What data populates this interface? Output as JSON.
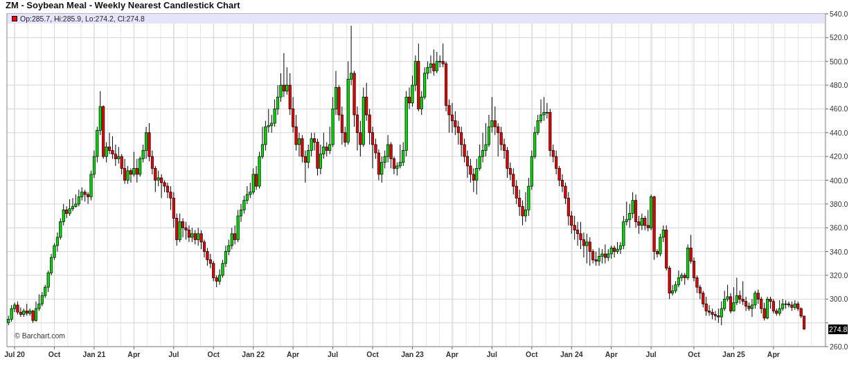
{
  "title": "ZM - Soybean Meal - Weekly Nearest Candlestick Chart",
  "legend": {
    "text": "Op:285.7, Hi:285.9, Lo:274.2, Cl:274.8"
  },
  "last_price": "274.8",
  "copyright": "© Barchart.com",
  "chart_data": {
    "type": "candlestick",
    "grid": true,
    "ylim": [
      260,
      540
    ],
    "yticks": [
      {
        "value": 260,
        "label": "260.0"
      },
      {
        "value": 300,
        "label": "300.0"
      },
      {
        "value": 320,
        "label": "320.0"
      },
      {
        "value": 340,
        "label": "340.0"
      },
      {
        "value": 360,
        "label": "360.0"
      },
      {
        "value": 380,
        "label": "380.0"
      },
      {
        "value": 400,
        "label": "400.0"
      },
      {
        "value": 420,
        "label": "420.0"
      },
      {
        "value": 440,
        "label": "440.0"
      },
      {
        "value": 460,
        "label": "460.0"
      },
      {
        "value": 480,
        "label": "480.0"
      },
      {
        "value": 500,
        "label": "500.0"
      },
      {
        "value": 520,
        "label": "520.0"
      },
      {
        "value": 540,
        "label": "540.0"
      }
    ],
    "categories": [
      null,
      null,
      "Jul 20",
      null,
      null,
      null,
      null,
      null,
      null,
      null,
      null,
      null,
      null,
      null,
      null,
      "Oct",
      null,
      null,
      null,
      null,
      null,
      null,
      null,
      null,
      null,
      null,
      null,
      null,
      "Jan 21",
      null,
      null,
      null,
      null,
      null,
      null,
      null,
      null,
      null,
      null,
      null,
      null,
      "Apr",
      null,
      null,
      null,
      null,
      null,
      null,
      null,
      null,
      null,
      null,
      null,
      null,
      "Jul",
      null,
      null,
      null,
      null,
      null,
      null,
      null,
      null,
      null,
      null,
      null,
      null,
      "Oct",
      null,
      null,
      null,
      null,
      null,
      null,
      null,
      null,
      null,
      null,
      null,
      null,
      "Jan 22",
      null,
      null,
      null,
      null,
      null,
      null,
      null,
      null,
      null,
      null,
      null,
      null,
      "Apr",
      null,
      null,
      null,
      null,
      null,
      null,
      null,
      null,
      null,
      null,
      null,
      null,
      "Jul",
      null,
      null,
      null,
      null,
      null,
      null,
      null,
      null,
      null,
      null,
      null,
      null,
      "Oct",
      null,
      null,
      null,
      null,
      null,
      null,
      null,
      null,
      null,
      null,
      null,
      null,
      "Jan 23",
      null,
      null,
      null,
      null,
      null,
      null,
      null,
      null,
      null,
      null,
      null,
      null,
      "Apr",
      null,
      null,
      null,
      null,
      null,
      null,
      null,
      null,
      null,
      null,
      null,
      null,
      "Jul",
      null,
      null,
      null,
      null,
      null,
      null,
      null,
      null,
      null,
      null,
      null,
      null,
      "Oct",
      null,
      null,
      null,
      null,
      null,
      null,
      null,
      null,
      null,
      null,
      null,
      null,
      "Jan 24",
      null,
      null,
      null,
      null,
      null,
      null,
      null,
      null,
      null,
      null,
      null,
      null,
      "Apr",
      null,
      null,
      null,
      null,
      null,
      null,
      null,
      null,
      null,
      null,
      null,
      null,
      "Jul",
      null,
      null,
      null,
      null,
      null,
      null,
      null,
      null,
      null,
      null,
      null,
      null,
      null,
      "Oct",
      null,
      null,
      null,
      null,
      null,
      null,
      null,
      null,
      null,
      null,
      null,
      null,
      "Jan 25",
      null,
      null,
      null,
      null,
      null,
      null,
      null,
      null,
      null,
      null,
      null,
      null,
      "Apr",
      null,
      null,
      null,
      null,
      null,
      null,
      null,
      null,
      null,
      null
    ],
    "ohlc": [
      [
        280,
        286,
        278,
        283
      ],
      [
        283,
        295,
        281,
        292
      ],
      [
        292,
        297,
        289,
        295
      ],
      [
        295,
        298,
        287,
        289
      ],
      [
        289,
        293,
        285,
        287
      ],
      [
        287,
        292,
        285,
        290
      ],
      [
        290,
        296,
        286,
        288
      ],
      [
        288,
        292,
        286,
        290
      ],
      [
        290,
        291,
        280,
        282
      ],
      [
        282,
        298,
        281,
        292
      ],
      [
        292,
        304,
        290,
        296
      ],
      [
        296,
        306,
        294,
        303
      ],
      [
        303,
        312,
        301,
        310
      ],
      [
        310,
        324,
        306,
        322
      ],
      [
        322,
        338,
        320,
        335
      ],
      [
        335,
        347,
        333,
        345
      ],
      [
        345,
        356,
        340,
        352
      ],
      [
        352,
        368,
        350,
        365
      ],
      [
        365,
        380,
        362,
        375
      ],
      [
        375,
        378,
        368,
        372
      ],
      [
        372,
        384,
        370,
        376
      ],
      [
        376,
        385,
        374,
        378
      ],
      [
        378,
        388,
        377,
        380
      ],
      [
        380,
        392,
        378,
        386
      ],
      [
        386,
        394,
        383,
        390
      ],
      [
        390,
        392,
        382,
        388
      ],
      [
        388,
        390,
        380,
        386
      ],
      [
        386,
        408,
        383,
        405
      ],
      [
        405,
        425,
        402,
        420
      ],
      [
        420,
        445,
        415,
        442
      ],
      [
        442,
        475,
        438,
        462
      ],
      [
        462,
        463,
        418,
        420
      ],
      [
        420,
        432,
        415,
        428
      ],
      [
        428,
        440,
        422,
        425
      ],
      [
        425,
        437,
        418,
        422
      ],
      [
        422,
        430,
        412,
        418
      ],
      [
        418,
        428,
        414,
        420
      ],
      [
        420,
        422,
        405,
        410
      ],
      [
        410,
        418,
        397,
        400
      ],
      [
        400,
        412,
        397,
        408
      ],
      [
        408,
        410,
        398,
        405
      ],
      [
        405,
        424,
        403,
        410
      ],
      [
        410,
        418,
        398,
        405
      ],
      [
        405,
        420,
        403,
        418
      ],
      [
        418,
        430,
        415,
        425
      ],
      [
        425,
        445,
        418,
        440
      ],
      [
        440,
        448,
        416,
        420
      ],
      [
        420,
        425,
        405,
        410
      ],
      [
        410,
        412,
        390,
        400
      ],
      [
        400,
        408,
        395,
        402
      ],
      [
        402,
        405,
        385,
        398
      ],
      [
        398,
        400,
        390,
        395
      ],
      [
        395,
        398,
        385,
        390
      ],
      [
        390,
        395,
        375,
        385
      ],
      [
        385,
        390,
        360,
        368
      ],
      [
        368,
        372,
        345,
        350
      ],
      [
        350,
        372,
        348,
        365
      ],
      [
        365,
        368,
        352,
        360
      ],
      [
        360,
        365,
        350,
        358
      ],
      [
        358,
        362,
        348,
        352
      ],
      [
        352,
        360,
        348,
        355
      ],
      [
        355,
        358,
        346,
        350
      ],
      [
        350,
        360,
        345,
        355
      ],
      [
        355,
        358,
        342,
        348
      ],
      [
        348,
        350,
        335,
        340
      ],
      [
        340,
        343,
        328,
        333
      ],
      [
        333,
        338,
        326,
        330
      ],
      [
        330,
        332,
        315,
        318
      ],
      [
        318,
        320,
        310,
        315
      ],
      [
        315,
        325,
        312,
        320
      ],
      [
        320,
        333,
        318,
        330
      ],
      [
        330,
        345,
        327,
        340
      ],
      [
        340,
        350,
        337,
        345
      ],
      [
        345,
        360,
        342,
        355
      ],
      [
        355,
        362,
        346,
        350
      ],
      [
        350,
        375,
        348,
        370
      ],
      [
        370,
        380,
        365,
        375
      ],
      [
        375,
        387,
        372,
        383
      ],
      [
        383,
        395,
        380,
        388
      ],
      [
        388,
        398,
        385,
        390
      ],
      [
        390,
        410,
        388,
        405
      ],
      [
        405,
        412,
        392,
        395
      ],
      [
        395,
        424,
        393,
        420
      ],
      [
        420,
        445,
        418,
        430
      ],
      [
        430,
        450,
        425,
        445
      ],
      [
        445,
        460,
        440,
        446
      ],
      [
        446,
        455,
        440,
        448
      ],
      [
        448,
        468,
        445,
        460
      ],
      [
        460,
        480,
        455,
        470
      ],
      [
        470,
        490,
        466,
        480
      ],
      [
        480,
        507,
        470,
        475
      ],
      [
        475,
        495,
        472,
        480
      ],
      [
        480,
        490,
        455,
        460
      ],
      [
        460,
        470,
        440,
        445
      ],
      [
        445,
        455,
        425,
        430
      ],
      [
        430,
        440,
        420,
        435
      ],
      [
        435,
        438,
        415,
        420
      ],
      [
        420,
        425,
        398,
        415
      ],
      [
        415,
        430,
        410,
        425
      ],
      [
        425,
        440,
        420,
        435
      ],
      [
        435,
        440,
        425,
        432
      ],
      [
        432,
        435,
        404,
        410
      ],
      [
        410,
        430,
        405,
        422
      ],
      [
        422,
        440,
        418,
        428
      ],
      [
        428,
        432,
        420,
        425
      ],
      [
        425,
        445,
        422,
        430
      ],
      [
        430,
        470,
        428,
        460
      ],
      [
        460,
        492,
        455,
        478
      ],
      [
        478,
        480,
        450,
        455
      ],
      [
        455,
        462,
        430,
        440
      ],
      [
        440,
        445,
        428,
        432
      ],
      [
        432,
        500,
        430,
        485
      ],
      [
        485,
        530,
        480,
        490
      ],
      [
        490,
        492,
        445,
        455
      ],
      [
        455,
        462,
        425,
        440
      ],
      [
        440,
        450,
        420,
        430
      ],
      [
        430,
        478,
        428,
        470
      ],
      [
        470,
        482,
        450,
        455
      ],
      [
        455,
        460,
        430,
        440
      ],
      [
        440,
        445,
        410,
        430
      ],
      [
        430,
        435,
        418,
        423
      ],
      [
        423,
        426,
        400,
        405
      ],
      [
        405,
        420,
        398,
        415
      ],
      [
        415,
        425,
        410,
        420
      ],
      [
        420,
        438,
        415,
        430
      ],
      [
        430,
        432,
        410,
        418
      ],
      [
        418,
        420,
        405,
        410
      ],
      [
        410,
        415,
        404,
        412
      ],
      [
        412,
        430,
        410,
        415
      ],
      [
        415,
        432,
        412,
        425
      ],
      [
        425,
        475,
        420,
        470
      ],
      [
        470,
        478,
        460,
        465
      ],
      [
        465,
        488,
        462,
        480
      ],
      [
        480,
        505,
        475,
        500
      ],
      [
        500,
        515,
        458,
        460
      ],
      [
        460,
        475,
        455,
        470
      ],
      [
        470,
        495,
        468,
        490
      ],
      [
        490,
        500,
        485,
        495
      ],
      [
        495,
        505,
        490,
        498
      ],
      [
        498,
        510,
        488,
        492
      ],
      [
        492,
        508,
        490,
        500
      ],
      [
        500,
        505,
        495,
        500
      ],
      [
        500,
        515,
        495,
        498
      ],
      [
        498,
        500,
        458,
        463
      ],
      [
        463,
        468,
        440,
        455
      ],
      [
        455,
        465,
        440,
        450
      ],
      [
        450,
        458,
        438,
        445
      ],
      [
        445,
        450,
        430,
        440
      ],
      [
        440,
        445,
        420,
        430
      ],
      [
        430,
        435,
        415,
        420
      ],
      [
        420,
        425,
        402,
        412
      ],
      [
        412,
        418,
        398,
        405
      ],
      [
        405,
        410,
        390,
        400
      ],
      [
        400,
        418,
        388,
        410
      ],
      [
        410,
        430,
        408,
        420
      ],
      [
        420,
        440,
        415,
        425
      ],
      [
        425,
        448,
        420,
        430
      ],
      [
        430,
        455,
        428,
        445
      ],
      [
        445,
        470,
        440,
        450
      ],
      [
        450,
        462,
        438,
        445
      ],
      [
        445,
        448,
        420,
        440
      ],
      [
        440,
        445,
        425,
        430
      ],
      [
        430,
        435,
        418,
        425
      ],
      [
        425,
        428,
        402,
        410
      ],
      [
        410,
        415,
        400,
        405
      ],
      [
        405,
        410,
        388,
        395
      ],
      [
        395,
        400,
        380,
        385
      ],
      [
        385,
        392,
        370,
        378
      ],
      [
        378,
        383,
        362,
        370
      ],
      [
        370,
        390,
        365,
        375
      ],
      [
        375,
        402,
        370,
        395
      ],
      [
        395,
        425,
        392,
        420
      ],
      [
        420,
        445,
        418,
        440
      ],
      [
        440,
        455,
        438,
        450
      ],
      [
        450,
        468,
        448,
        455
      ],
      [
        455,
        470,
        450,
        457
      ],
      [
        457,
        465,
        452,
        457
      ],
      [
        457,
        460,
        420,
        425
      ],
      [
        425,
        430,
        415,
        420
      ],
      [
        420,
        425,
        405,
        410
      ],
      [
        410,
        412,
        395,
        400
      ],
      [
        400,
        405,
        390,
        395
      ],
      [
        395,
        398,
        380,
        385
      ],
      [
        385,
        390,
        362,
        370
      ],
      [
        370,
        374,
        355,
        362
      ],
      [
        362,
        370,
        350,
        358
      ],
      [
        358,
        365,
        345,
        355
      ],
      [
        355,
        365,
        342,
        350
      ],
      [
        350,
        356,
        335,
        345
      ],
      [
        345,
        355,
        330,
        348
      ],
      [
        348,
        352,
        328,
        340
      ],
      [
        340,
        342,
        330,
        333
      ],
      [
        333,
        340,
        328,
        332
      ],
      [
        332,
        343,
        328,
        336
      ],
      [
        336,
        342,
        330,
        338
      ],
      [
        338,
        346,
        330,
        335
      ],
      [
        335,
        342,
        332,
        338
      ],
      [
        338,
        345,
        334,
        343
      ],
      [
        343,
        345,
        335,
        340
      ],
      [
        340,
        348,
        338,
        342
      ],
      [
        342,
        348,
        338,
        345
      ],
      [
        345,
        370,
        342,
        365
      ],
      [
        365,
        382,
        362,
        367
      ],
      [
        367,
        380,
        360,
        372
      ],
      [
        372,
        390,
        368,
        383
      ],
      [
        383,
        388,
        360,
        365
      ],
      [
        365,
        370,
        355,
        362
      ],
      [
        362,
        372,
        358,
        368
      ],
      [
        368,
        370,
        358,
        362
      ],
      [
        362,
        375,
        357,
        360
      ],
      [
        360,
        388,
        358,
        386
      ],
      [
        386,
        387,
        333,
        340
      ],
      [
        340,
        342,
        335,
        338
      ],
      [
        338,
        355,
        336,
        352
      ],
      [
        352,
        362,
        348,
        358
      ],
      [
        358,
        362,
        324,
        326
      ],
      [
        326,
        328,
        300,
        305
      ],
      [
        305,
        312,
        303,
        307
      ],
      [
        307,
        315,
        305,
        312
      ],
      [
        312,
        324,
        310,
        318
      ],
      [
        318,
        322,
        315,
        320
      ],
      [
        320,
        322,
        312,
        318
      ],
      [
        318,
        346,
        316,
        343
      ],
      [
        343,
        354,
        330,
        332
      ],
      [
        332,
        335,
        315,
        318
      ],
      [
        318,
        320,
        305,
        310
      ],
      [
        310,
        312,
        300,
        305
      ],
      [
        305,
        307,
        293,
        296
      ],
      [
        296,
        302,
        286,
        290
      ],
      [
        290,
        295,
        286,
        289
      ],
      [
        289,
        292,
        283,
        287
      ],
      [
        287,
        290,
        282,
        286
      ],
      [
        286,
        292,
        280,
        285
      ],
      [
        285,
        298,
        278,
        292
      ],
      [
        292,
        307,
        290,
        300
      ],
      [
        300,
        312,
        298,
        302
      ],
      [
        302,
        305,
        288,
        290
      ],
      [
        290,
        310,
        290,
        297
      ],
      [
        297,
        318,
        295,
        303
      ],
      [
        303,
        307,
        296,
        300
      ],
      [
        300,
        315,
        295,
        298
      ],
      [
        298,
        302,
        290,
        294
      ],
      [
        294,
        297,
        290,
        292
      ],
      [
        292,
        300,
        285,
        295
      ],
      [
        295,
        307,
        292,
        305
      ],
      [
        305,
        308,
        296,
        300
      ],
      [
        300,
        302,
        288,
        292
      ],
      [
        292,
        297,
        282,
        284
      ],
      [
        284,
        302,
        283,
        300
      ],
      [
        300,
        302,
        292,
        298
      ],
      [
        298,
        300,
        288,
        290
      ],
      [
        290,
        292,
        286,
        288
      ],
      [
        288,
        299,
        286,
        292
      ],
      [
        292,
        300,
        290,
        296
      ],
      [
        296,
        299,
        292,
        296
      ],
      [
        296,
        298,
        293,
        295
      ],
      [
        295,
        298,
        290,
        293
      ],
      [
        293,
        299,
        291,
        296
      ],
      [
        296,
        298,
        290,
        292
      ],
      [
        292,
        293,
        284,
        285.7
      ],
      [
        285.7,
        285.9,
        274.2,
        274.8
      ]
    ]
  }
}
